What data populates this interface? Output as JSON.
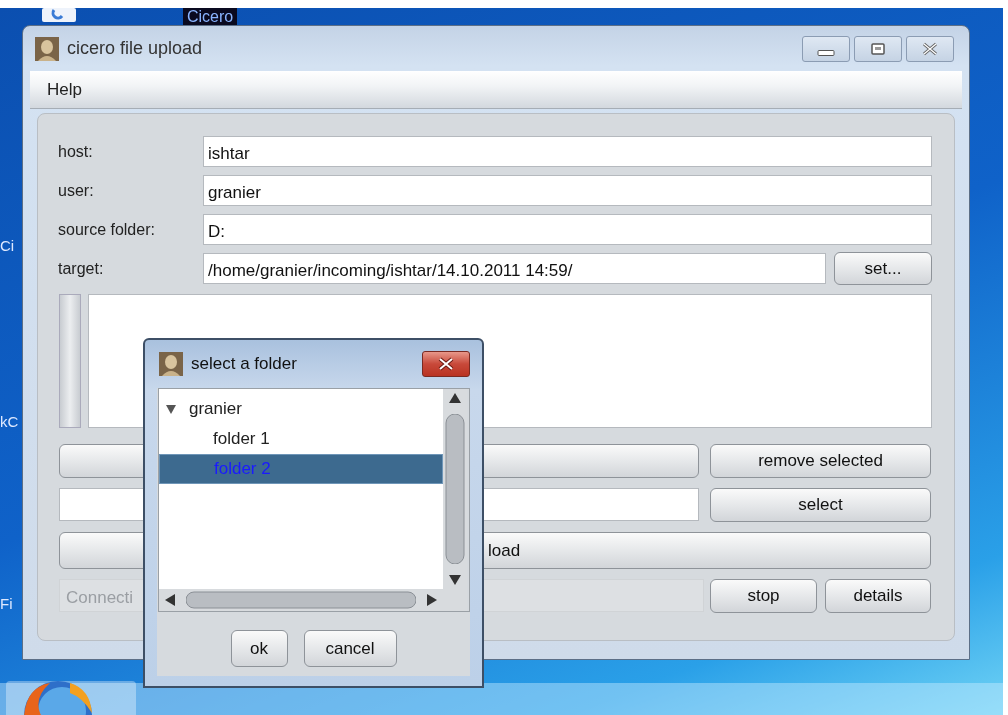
{
  "desktop": {
    "icon_labels": [
      {
        "text": "Cicero",
        "kind": "top"
      },
      {
        "text": "Ci",
        "kind": "left"
      },
      {
        "text": "kC",
        "kind": "left"
      },
      {
        "text": "Fi",
        "kind": "left"
      }
    ]
  },
  "window": {
    "title": "cicero file upload",
    "menu": [
      "Help"
    ],
    "fields": [
      {
        "label": "host:",
        "value": "ishtar"
      },
      {
        "label": "user:",
        "value": "granier"
      },
      {
        "label": "source folder:",
        "value": "D:"
      },
      {
        "label": "target:",
        "value": "/home/granier/incoming/ishtar/14.10.2011 14:59/",
        "button": "set..."
      }
    ],
    "remove_button": "remove selected",
    "select_button": "select",
    "upload_button": "load",
    "status": {
      "value": "Connecti",
      "disabled": true
    },
    "status_buttons": [
      "stop",
      "details"
    ]
  },
  "dialog": {
    "title": "select a folder",
    "tree": [
      {
        "label": "granier",
        "expanded": true,
        "selected": false,
        "children": [
          {
            "label": "folder 1",
            "selected": false
          },
          {
            "label": "folder 2",
            "selected": true
          }
        ]
      }
    ],
    "buttons": [
      "ok",
      "cancel"
    ]
  }
}
